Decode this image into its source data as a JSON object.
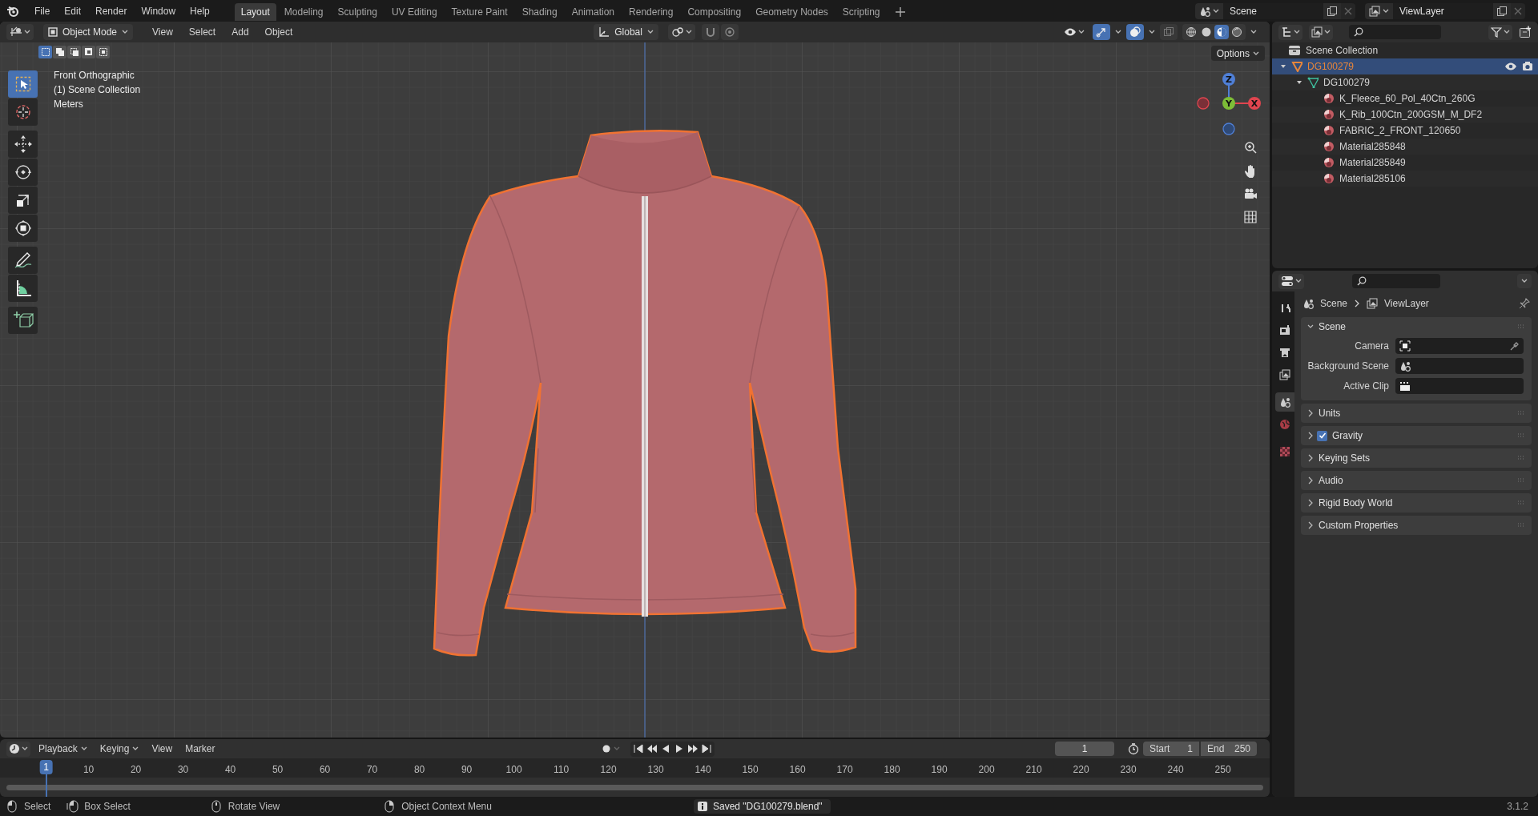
{
  "menu_bar": {
    "menus": [
      "File",
      "Edit",
      "Render",
      "Window",
      "Help"
    ]
  },
  "workspace_tabs": [
    {
      "label": "Layout",
      "selected": true
    },
    {
      "label": "Modeling",
      "selected": false
    },
    {
      "label": "Sculpting",
      "selected": false
    },
    {
      "label": "UV Editing",
      "selected": false
    },
    {
      "label": "Texture Paint",
      "selected": false
    },
    {
      "label": "Shading",
      "selected": false
    },
    {
      "label": "Animation",
      "selected": false
    },
    {
      "label": "Rendering",
      "selected": false
    },
    {
      "label": "Compositing",
      "selected": false
    },
    {
      "label": "Geometry Nodes",
      "selected": false
    },
    {
      "label": "Scripting",
      "selected": false
    }
  ],
  "scene_selector": {
    "value": "Scene"
  },
  "view_layer_selector": {
    "value": "ViewLayer"
  },
  "viewport": {
    "mode": "Object Mode",
    "menus": [
      "View",
      "Select",
      "Add",
      "Object"
    ],
    "orientation": "Global",
    "toggles": [
      {
        "kind": "snap",
        "on": false
      },
      {
        "kind": "proportional",
        "on": false
      },
      {
        "kind": "gizmo",
        "on": true
      },
      {
        "kind": "overlay",
        "on": true
      },
      {
        "kind": "xray",
        "on": false
      }
    ],
    "shading_modes": [
      {
        "kind": "wireframe",
        "selected": false
      },
      {
        "kind": "solid",
        "selected": false
      },
      {
        "kind": "material",
        "selected": true
      },
      {
        "kind": "rendered",
        "selected": false
      }
    ],
    "select_modes": [
      {
        "selected": true
      },
      {
        "selected": false
      },
      {
        "selected": false
      },
      {
        "selected": false
      },
      {
        "selected": false
      }
    ],
    "options": "Options",
    "info": [
      "Front Orthographic",
      "(1) Scene Collection",
      "Meters"
    ],
    "tools": [
      {
        "kind": "select",
        "selected": true
      },
      {
        "kind": "cursor",
        "selected": false
      },
      {
        "kind": "move",
        "selected": false
      },
      {
        "kind": "rotate",
        "selected": false
      },
      {
        "kind": "scale",
        "selected": false
      },
      {
        "kind": "transform",
        "selected": false
      },
      {
        "kind": "annotate",
        "selected": false
      },
      {
        "kind": "measure",
        "selected": false
      },
      {
        "kind": "add_cube",
        "selected": false
      }
    ],
    "axes": [
      {
        "kind": "z",
        "label": "Z"
      },
      {
        "kind": "x",
        "label": "X"
      },
      {
        "kind": "y",
        "label": "Y"
      }
    ]
  },
  "outliner": {
    "root": "Scene Collection",
    "tree": [
      {
        "kind": "object",
        "label": "DG100279",
        "selected": true,
        "expanded": true,
        "children": [
          {
            "kind": "mesh",
            "label": "DG100279",
            "selected": false,
            "expanded": true,
            "children": [
              {
                "kind": "material",
                "label": "K_Fleece_60_Pol_40Ctn_260G",
                "selected": false
              },
              {
                "kind": "material",
                "label": "K_Rib_100Ctn_200GSM_M_DF2",
                "selected": false
              },
              {
                "kind": "material",
                "label": "FABRIC_2_FRONT_120650",
                "selected": false
              },
              {
                "kind": "material",
                "label": "Material285848",
                "selected": false
              },
              {
                "kind": "material",
                "label": "Material285849",
                "selected": false
              },
              {
                "kind": "material",
                "label": "Material285106",
                "selected": false
              }
            ]
          }
        ]
      }
    ]
  },
  "properties": {
    "tabs": [
      {
        "kind": "tool",
        "selected": false
      },
      {
        "kind": "render",
        "selected": false
      },
      {
        "kind": "output",
        "selected": false
      },
      {
        "kind": "view_layer",
        "selected": false
      },
      {
        "kind": "scene",
        "selected": true
      },
      {
        "kind": "world",
        "selected": false
      },
      {
        "kind": "texture",
        "selected": false
      }
    ],
    "breadcrumb": [
      "Scene",
      "ViewLayer"
    ],
    "panels": [
      {
        "kind": "section",
        "title": "Scene",
        "expanded": true,
        "fields": [
          {
            "kind": "camera",
            "label": "Camera"
          },
          {
            "kind": "scene",
            "label": "Background Scene"
          },
          {
            "kind": "clip",
            "label": "Active Clip"
          }
        ]
      },
      {
        "kind": "section",
        "title": "Units",
        "expanded": false
      },
      {
        "kind": "checkbox",
        "title": "Gravity",
        "expanded": false,
        "checked": true
      },
      {
        "kind": "section",
        "title": "Keying Sets",
        "expanded": false
      },
      {
        "kind": "section",
        "title": "Audio",
        "expanded": false
      },
      {
        "kind": "section",
        "title": "Rigid Body World",
        "expanded": false
      },
      {
        "kind": "section",
        "title": "Custom Properties",
        "expanded": false
      }
    ]
  },
  "timeline": {
    "menus": [
      "Playback",
      "Keying",
      "View",
      "Marker"
    ],
    "current_frame": "1",
    "start_label": "Start",
    "start": "1",
    "end_label": "End",
    "end": "250",
    "playhead": "1",
    "ticks": [
      "10",
      "20",
      "30",
      "40",
      "50",
      "60",
      "70",
      "80",
      "90",
      "100",
      "110",
      "120",
      "130",
      "140",
      "150",
      "160",
      "170",
      "180",
      "190",
      "200",
      "210",
      "220",
      "230",
      "240",
      "250"
    ]
  },
  "status_bar": {
    "hints": [
      {
        "kind": "left",
        "label": "Select"
      },
      {
        "kind": "drag",
        "label": "Box Select"
      },
      {
        "kind": "middle",
        "label": "Rotate View"
      },
      {
        "kind": "right",
        "label": "Object Context Menu"
      }
    ],
    "message": "Saved \"DG100279.blend\"",
    "version": "3.1.2"
  }
}
